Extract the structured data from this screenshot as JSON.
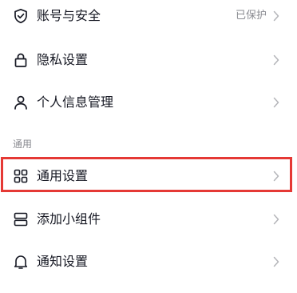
{
  "items": [
    {
      "label": "账号与安全",
      "value": "已保护",
      "icon": "shield-check-icon"
    },
    {
      "label": "隐私设置",
      "icon": "lock-icon"
    },
    {
      "label": "个人信息管理",
      "icon": "person-icon"
    }
  ],
  "section": {
    "title": "通用"
  },
  "general_items": [
    {
      "label": "通用设置",
      "icon": "grid-icon"
    },
    {
      "label": "添加小组件",
      "icon": "widget-icon"
    },
    {
      "label": "通知设置",
      "icon": "bell-icon"
    }
  ],
  "colors": {
    "text": "#161823",
    "muted": "#8a8b91",
    "highlight": "#e53935",
    "chevron": "#b4b5b9"
  }
}
